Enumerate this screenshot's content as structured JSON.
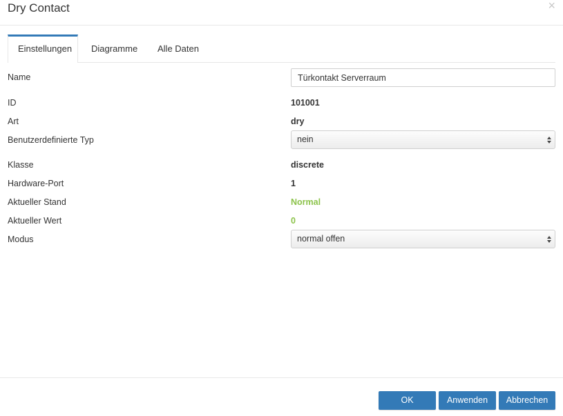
{
  "dialog": {
    "title": "Dry Contact",
    "close_glyph": "×"
  },
  "tabs": [
    {
      "label": "Einstellungen",
      "active": true
    },
    {
      "label": "Diagramme",
      "active": false
    },
    {
      "label": "Alle Daten",
      "active": false
    }
  ],
  "fields": {
    "name": {
      "label": "Name",
      "value": "Türkontakt Serverraum"
    },
    "id": {
      "label": "ID",
      "value": "101001"
    },
    "art": {
      "label": "Art",
      "value": "dry"
    },
    "custom_type": {
      "label": "Benutzerdefinierte Typ",
      "value": "nein"
    },
    "klasse": {
      "label": "Klasse",
      "value": "discrete"
    },
    "hardware_port": {
      "label": "Hardware-Port",
      "value": "1"
    },
    "state": {
      "label": "Aktueller Stand",
      "value": "Normal"
    },
    "current_value": {
      "label": "Aktueller Wert",
      "value": "0"
    },
    "mode": {
      "label": "Modus",
      "value": "normal offen"
    }
  },
  "buttons": {
    "ok": "OK",
    "apply": "Anwenden",
    "cancel": "Abbrechen"
  },
  "colors": {
    "accent": "#337ab7",
    "status_green": "#8cc34b"
  }
}
